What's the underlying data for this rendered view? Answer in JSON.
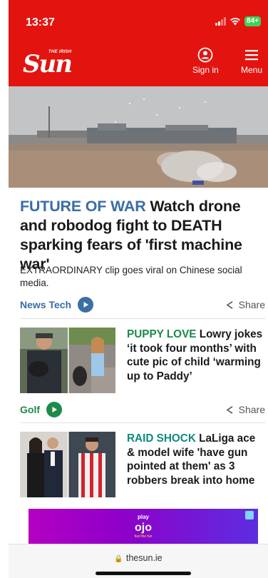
{
  "status_bar": {
    "time": "13:37",
    "battery": "84+"
  },
  "header": {
    "logo_small": "THE IRISH",
    "logo_main": "Sun",
    "signin_label": "Sign in",
    "menu_label": "Menu"
  },
  "lead_story": {
    "kicker": "FUTURE OF WAR",
    "headline": "Watch drone and robodog fight to DEATH sparking fears of 'first machine war'",
    "standfirst": "EXTRAORDINARY clip goes viral on Chinese social media.",
    "section": "News Tech",
    "share_label": "Share"
  },
  "stories": [
    {
      "kicker": "PUPPY LOVE",
      "headline": "Lowry jokes ‘it took four months’ with cute pic of child ‘warming up to Paddy’",
      "section": "Golf",
      "share_label": "Share"
    },
    {
      "kicker": "RAID SHOCK",
      "headline": "LaLiga ace & model wife 'have gun pointed at them' as 3 robbers break into home"
    }
  ],
  "ad": {
    "brand": "play ojo",
    "tagline": "feel the fun"
  },
  "browser": {
    "url": "thesun.ie"
  },
  "colors": {
    "brand_red": "#e3140f",
    "news_blue": "#3a6ea5",
    "golf_green": "#1e8a4a",
    "sport_teal": "#0f8a7e"
  }
}
